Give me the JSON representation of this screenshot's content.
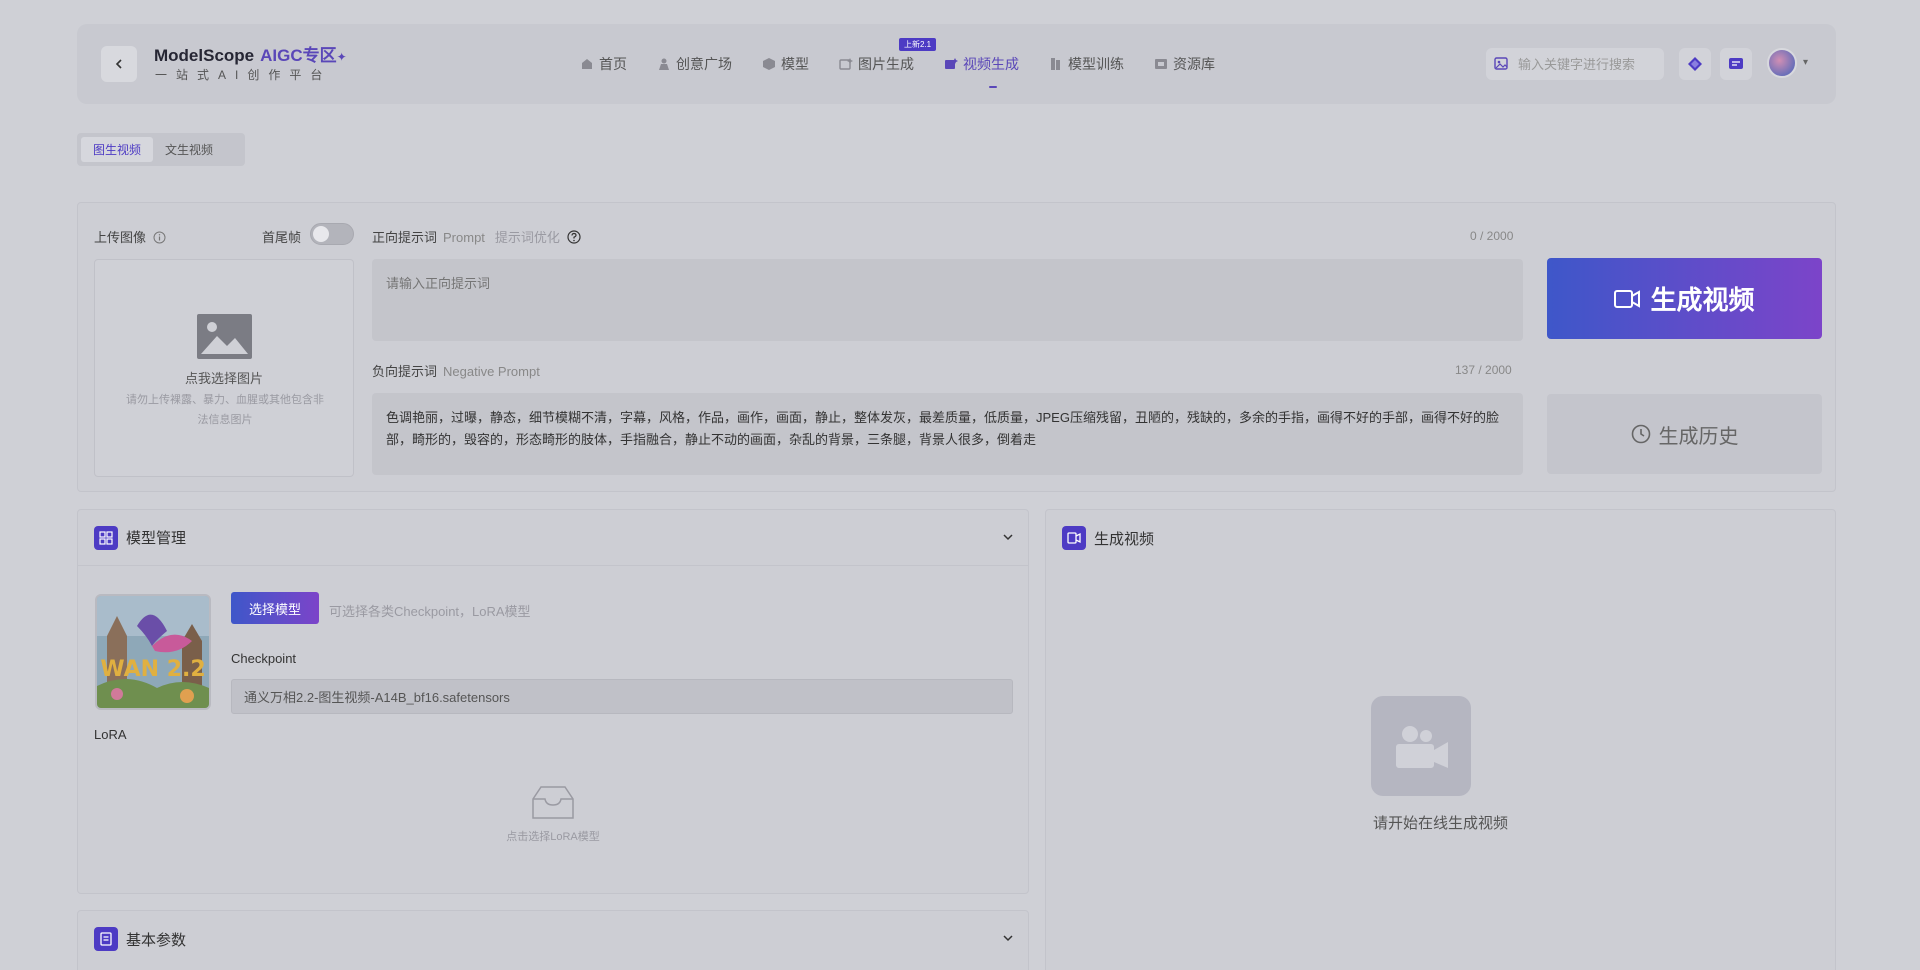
{
  "header": {
    "brand": "ModelScope",
    "brand_tag": "AIGC专区",
    "subtitle": "一站式AI创作平台",
    "nav": [
      {
        "label": "首页",
        "icon": "home-icon"
      },
      {
        "label": "创意广场",
        "icon": "user-icon"
      },
      {
        "label": "模型",
        "icon": "cube-icon"
      },
      {
        "label": "图片生成",
        "icon": "image-spark-icon"
      },
      {
        "label": "视频生成",
        "icon": "video-spark-icon",
        "active": true,
        "badge": "上新2.1"
      },
      {
        "label": "模型训练",
        "icon": "book-icon"
      },
      {
        "label": "资源库",
        "icon": "archive-icon"
      }
    ],
    "search_placeholder": "输入关键字进行搜索"
  },
  "mode_tabs": [
    {
      "label": "图生视频",
      "active": true
    },
    {
      "label": "文生视频",
      "active": false
    }
  ],
  "prompt_panel": {
    "upload_label": "上传图像",
    "first_last_frame_label": "首尾帧",
    "upload_text": "点我选择图片",
    "upload_note": "请勿上传裸露、暴力、血腥或其他包含非法信息图片",
    "positive_label": "正向提示词",
    "positive_label_en": "Prompt",
    "prompt_optimize": "提示词优化",
    "positive_placeholder": "请输入正向提示词",
    "positive_count": "0 / 2000",
    "negative_label": "负向提示词",
    "negative_label_en": "Negative Prompt",
    "negative_value": "色调艳丽，过曝，静态，细节模糊不清，字幕，风格，作品，画作，画面，静止，整体发灰，最差质量，低质量，JPEG压缩残留，丑陋的，残缺的，多余的手指，画得不好的手部，画得不好的脸部，畸形的，毁容的，形态畸形的肢体，手指融合，静止不动的画面，杂乱的背景，三条腿，背景人很多，倒着走",
    "negative_count": "137 / 2000",
    "generate_label": "生成视频",
    "history_label": "生成历史"
  },
  "model_panel": {
    "title": "模型管理",
    "select_button": "选择模型",
    "select_hint": "可选择各类Checkpoint，LoRA模型",
    "checkpoint_label": "Checkpoint",
    "checkpoint_value": "通义万相2.2-图生视频-A14B_bf16.safetensors",
    "lora_label": "LoRA",
    "lora_empty": "点击选择LoRA模型",
    "thumb_text": "WAN 2.2"
  },
  "output_panel": {
    "title": "生成视频",
    "empty_text": "请开始在线生成视频"
  },
  "params_panel": {
    "title": "基本参数"
  },
  "colors": {
    "accent": "#4d3bc4",
    "gradient_start": "#3e57c9",
    "gradient_end": "#7c44c9"
  }
}
